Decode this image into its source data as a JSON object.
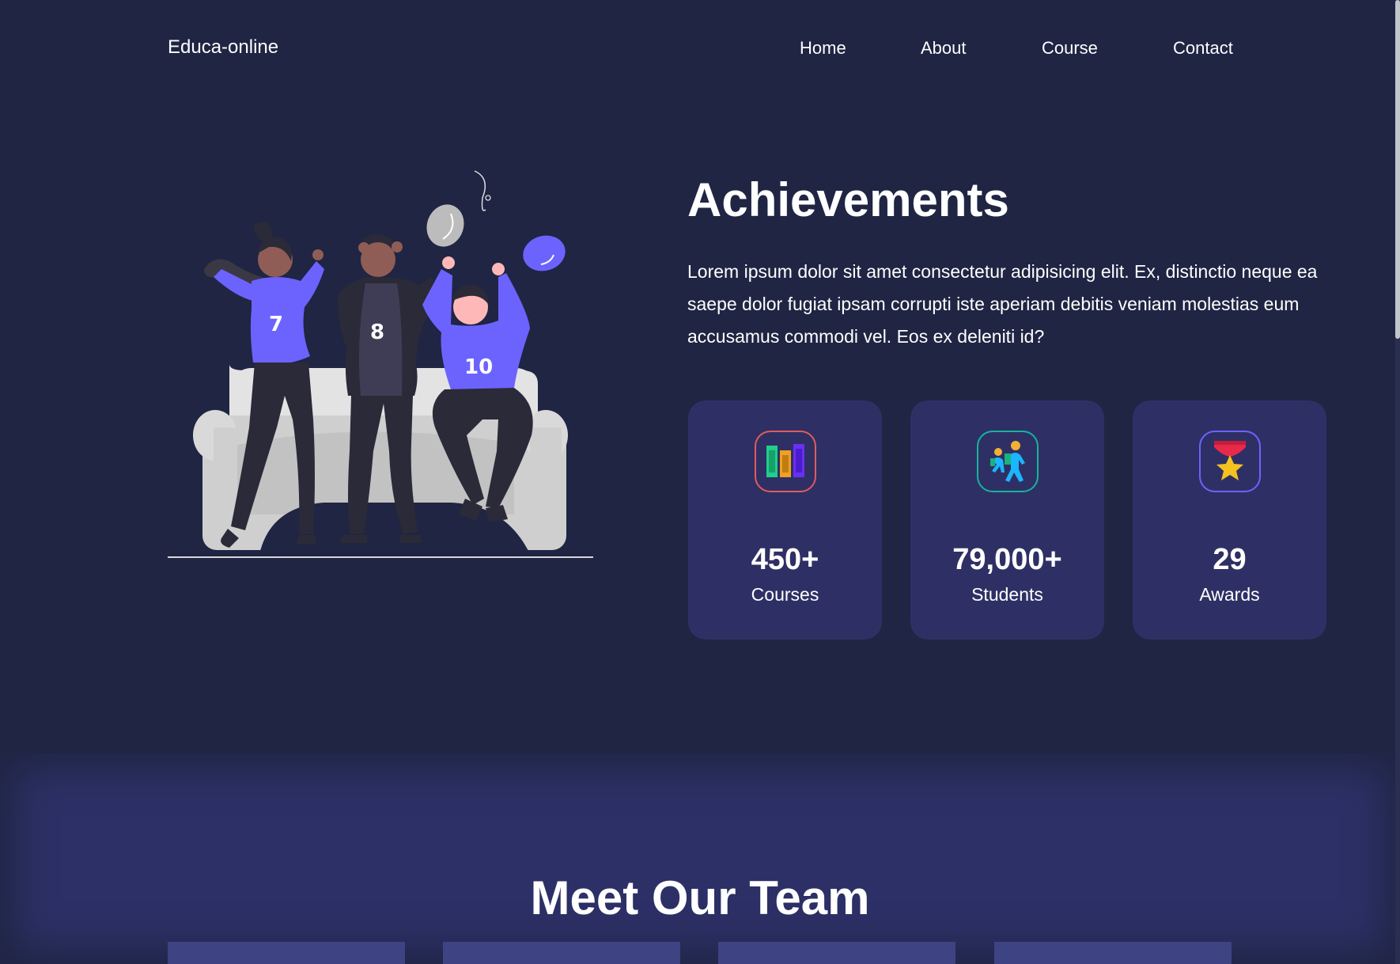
{
  "nav": {
    "brand": "Educa-online",
    "links": [
      "Home",
      "About",
      "Course",
      "Contact"
    ]
  },
  "achievements": {
    "title": "Achievements",
    "description": "Lorem ipsum dolor sit amet consectetur adipisicing elit. Ex, distinctio neque ea saepe dolor fugiat ipsam corrupti iste aperiam debitis veniam molestias eum accusamus commodi vel. Eos ex deleniti id?",
    "illustration": {
      "icon": "celebrating-people-illustration",
      "jersey_numbers": [
        "7",
        "8",
        "10"
      ]
    },
    "stats": [
      {
        "value": "450+",
        "label": "Courses",
        "icon": "books-icon",
        "border_color": "#e25b5b"
      },
      {
        "value": "79,000+",
        "label": "Students",
        "icon": "students-walking-icon",
        "border_color": "#17b39c"
      },
      {
        "value": "29",
        "label": "Awards",
        "icon": "medal-icon",
        "border_color": "#6c63ff"
      }
    ]
  },
  "team": {
    "title": "Meet Our Team",
    "card_count": 4
  },
  "colors": {
    "background": "#1f2543",
    "card": "#2e3065",
    "team_section": "#2d3066",
    "team_card": "#3e4384",
    "accent": "#6c63ff"
  }
}
